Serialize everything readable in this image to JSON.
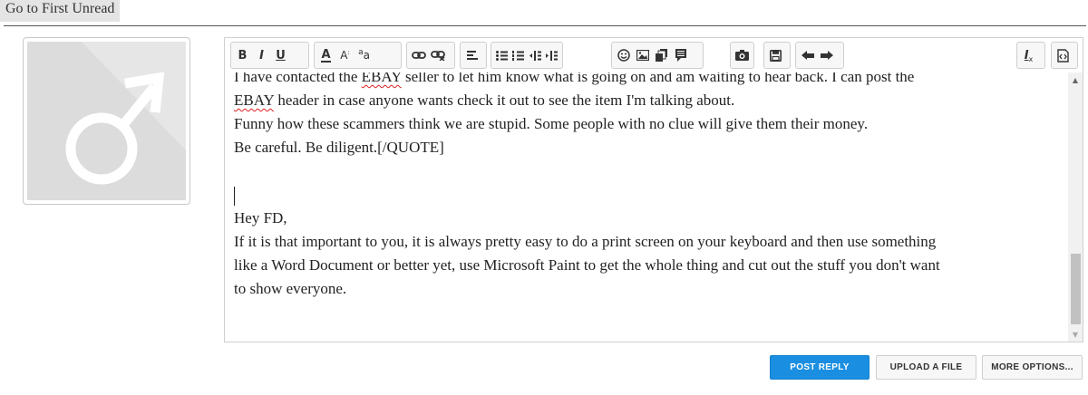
{
  "nav": {
    "first_unread_label": "Go to First Unread"
  },
  "avatar": {
    "icon": "male-symbol-icon"
  },
  "toolbar": {
    "bold": "B",
    "italic": "I",
    "underline": "U",
    "font_color": "A",
    "font_size": "A",
    "font_family": "a",
    "link": "link-icon",
    "unlink": "unlink-icon",
    "align": "align-icon",
    "unordered_list": "bullet-list-icon",
    "ordered_list": "numbered-list-icon",
    "outdent": "outdent-icon",
    "indent": "indent-icon",
    "smilies": "smiley-icon",
    "image": "image-icon",
    "media": "media-icon",
    "quote": "quote-icon",
    "camera": "camera-icon",
    "save": "save-draft-icon",
    "undo": "undo-icon",
    "redo": "redo-icon",
    "remove_format": "I",
    "remove_format_sub": "x",
    "bbcode": "bbcode-toggle-icon"
  },
  "editor": {
    "lines": [
      {
        "pre": "I have contacted the ",
        "misspelled": "EBAY",
        "post": " seller to let him know what is going on and am waiting to hear back. I can post the"
      },
      {
        "pre": "",
        "misspelled": "EBAY",
        "post": " header in case anyone wants check it out to see the item I'm talking about."
      },
      {
        "text": "Funny how these scammers think we are stupid. Some people with no clue will give them their money."
      },
      {
        "text": "Be careful. Be diligent.[/QUOTE]"
      },
      {
        "text": ""
      },
      {
        "text": ""
      },
      {
        "text": "Hey FD,"
      },
      {
        "text": "If it is that important to you, it is always pretty easy to do a print screen on your keyboard and then use something"
      },
      {
        "text": "like a Word Document or better yet, use Microsoft Paint to get the whole thing and cut out the stuff you don't want"
      },
      {
        "text": "to show everyone."
      }
    ]
  },
  "actions": {
    "post_reply": "POST REPLY",
    "upload_file": "UPLOAD A FILE",
    "more_options": "MORE OPTIONS..."
  },
  "colors": {
    "accent": "#1a8ee1",
    "misspell": "#dd2222"
  }
}
